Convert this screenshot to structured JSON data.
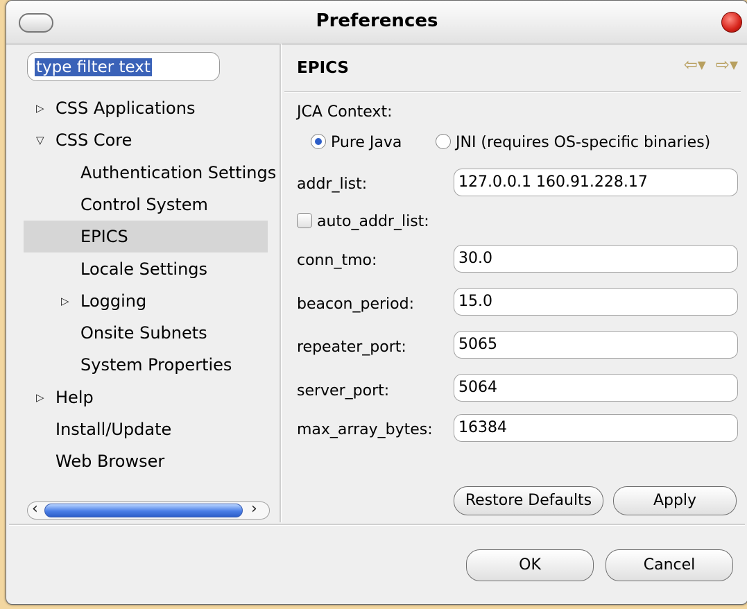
{
  "window": {
    "title": "Preferences"
  },
  "filter": {
    "text": "type filter text"
  },
  "tree": [
    {
      "label": "CSS Applications",
      "arrow": "▷",
      "level": 0
    },
    {
      "label": "CSS Core",
      "arrow": "▽",
      "level": 0
    },
    {
      "label": "Authentication Settings",
      "arrow": "",
      "level": 1
    },
    {
      "label": "Control System",
      "arrow": "",
      "level": 1
    },
    {
      "label": "EPICS",
      "arrow": "",
      "level": 1,
      "selected": true
    },
    {
      "label": "Locale Settings",
      "arrow": "",
      "level": 1
    },
    {
      "label": "Logging",
      "arrow": "▷",
      "level": 1
    },
    {
      "label": "Onsite Subnets",
      "arrow": "",
      "level": 1
    },
    {
      "label": "System Properties",
      "arrow": "",
      "level": 1
    },
    {
      "label": "Help",
      "arrow": "▷",
      "level": 0
    },
    {
      "label": "Install/Update",
      "arrow": "",
      "level": 0
    },
    {
      "label": "Web Browser",
      "arrow": "",
      "level": 0
    }
  ],
  "page": {
    "title": "EPICS",
    "jca_context_label": "JCA Context:",
    "radio_pure_java": "Pure Java",
    "radio_jni": "JNI (requires OS-specific binaries)",
    "addr_list_label": "addr_list:",
    "addr_list_value": "127.0.0.1 160.91.228.17",
    "auto_addr_list_label": "auto_addr_list:",
    "conn_tmo_label": "conn_tmo:",
    "conn_tmo_value": "30.0",
    "beacon_period_label": "beacon_period:",
    "beacon_period_value": "15.0",
    "repeater_port_label": "repeater_port:",
    "repeater_port_value": "5065",
    "server_port_label": "server_port:",
    "server_port_value": "5064",
    "max_array_bytes_label": "max_array_bytes:",
    "max_array_bytes_value": "16384"
  },
  "buttons": {
    "restore_defaults": "Restore Defaults",
    "apply": "Apply",
    "ok": "OK",
    "cancel": "Cancel"
  },
  "colors": {
    "selection": "#3a62b8",
    "tree_selected": "#d6d6d6",
    "close_button": "#d6231a"
  }
}
